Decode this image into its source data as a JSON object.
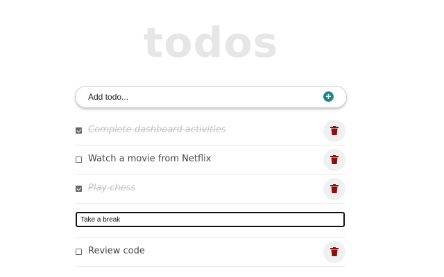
{
  "header": {
    "title": "todos"
  },
  "add_bar": {
    "placeholder": "Add todo...",
    "button_icon": "plus-circle-icon",
    "accent": "#1b8a86"
  },
  "todos": [
    {
      "text": "Complete dashboard activities",
      "completed": true
    },
    {
      "text": "Watch a movie from Netflix",
      "completed": false
    },
    {
      "text": "Play chess",
      "completed": true
    },
    {
      "text": "Take a break",
      "editing": true
    },
    {
      "text": "Review code",
      "completed": false
    }
  ],
  "icons": {
    "delete": "trash-icon",
    "delete_color": "#8b1010"
  }
}
